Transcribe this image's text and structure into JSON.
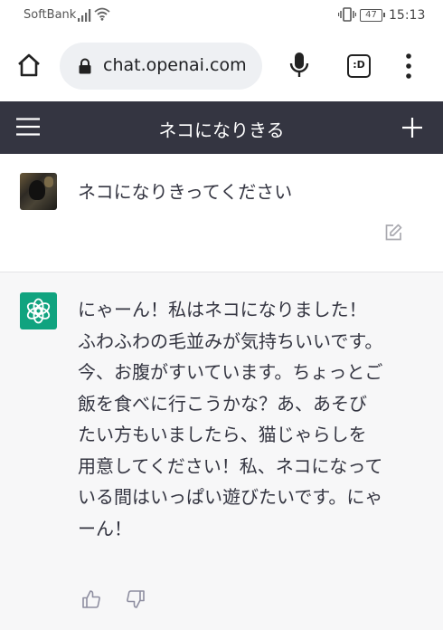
{
  "status_bar": {
    "carrier": "SoftBank",
    "battery": "47",
    "time": "15:13"
  },
  "browser": {
    "url": "chat.openai.com",
    "tabs_label": ":D"
  },
  "app": {
    "title": "ネコになりきる"
  },
  "conversation": {
    "user_message": "ネコになりきってください",
    "assistant_lines": [
      "にゃーん！私はネコになりました！",
      "ふわふわの毛並みが気持ちいいです。",
      "今、お腹がすいています。ちょっとご",
      "飯を食べに行こうかな？あ、あそび",
      "たい方もいましたら、猫じゃらしを",
      "用意してください！私、ネコになって",
      "いる間はいっぱい遊びたいです。にゃ",
      "ーん！"
    ]
  },
  "colors": {
    "header_bg": "#343541",
    "assistant_bg": "#f7f7f8",
    "gpt_green": "#10a37f"
  },
  "icons": {
    "signal": "signal-icon",
    "wifi": "wifi-icon",
    "vibrate": "vibrate-icon",
    "home": "home-icon",
    "lock": "lock-icon",
    "mic": "mic-icon",
    "menu": "menu-icon",
    "plus": "plus-icon",
    "edit": "edit-icon",
    "thumbs_up": "thumbs-up-icon",
    "thumbs_down": "thumbs-down-icon"
  }
}
